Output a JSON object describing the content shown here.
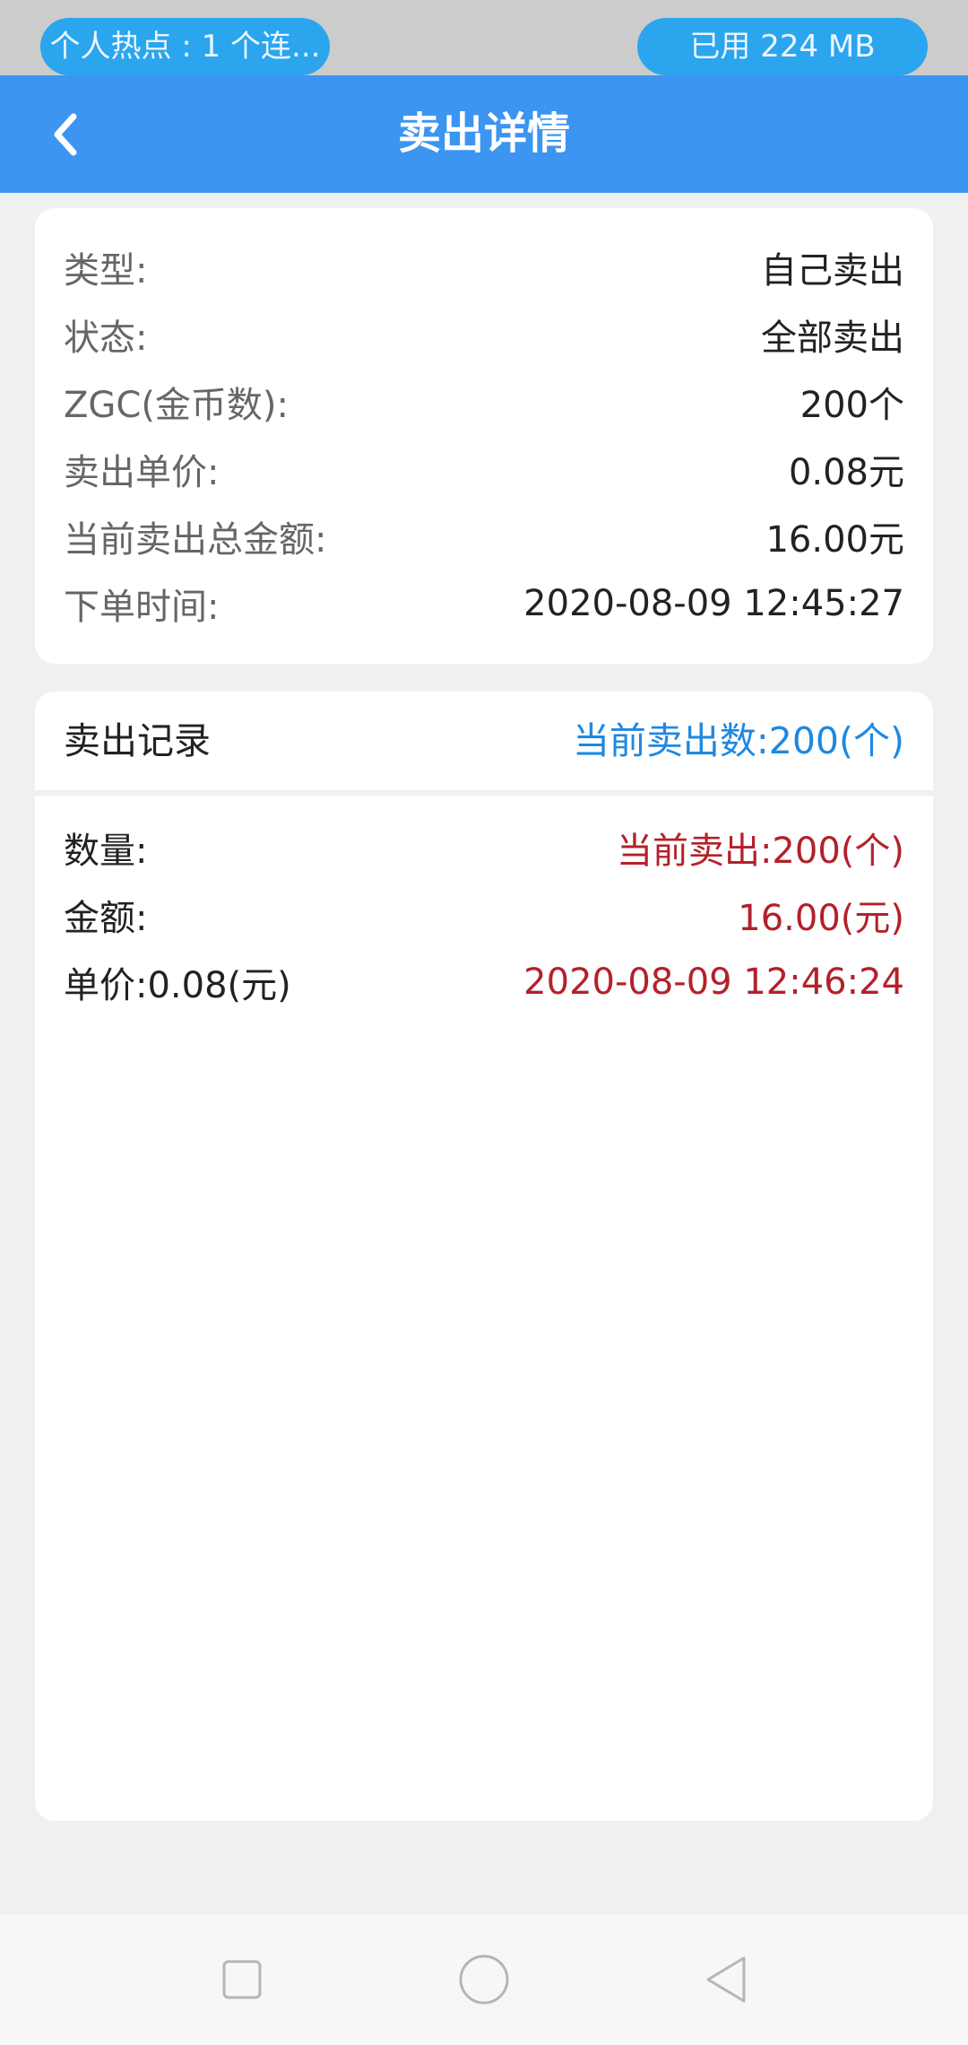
{
  "status_bar": {
    "hotspot": "个人热点 : 1 个连...",
    "data_usage": "已用 224 MB"
  },
  "header": {
    "title": "卖出详情",
    "back_icon": "chevron-left-icon"
  },
  "details": [
    {
      "label": "类型:",
      "value": "自己卖出"
    },
    {
      "label": "状态:",
      "value": "全部卖出"
    },
    {
      "label": "ZGC(金币数):",
      "value": "200个"
    },
    {
      "label": "卖出单价:",
      "value": "0.08元"
    },
    {
      "label": "当前卖出总金额:",
      "value": "16.00元"
    },
    {
      "label": "下单时间:",
      "value": "2020-08-09 12:45:27"
    }
  ],
  "records": {
    "title": "卖出记录",
    "count": "当前卖出数:200(个)",
    "items": [
      {
        "quantity_label": "数量:",
        "quantity_value": "当前卖出:200(个)",
        "amount_label": "金额:",
        "amount_value": "16.00(元)",
        "price": "单价:0.08(元)",
        "time": "2020-08-09 12:46:24"
      }
    ]
  },
  "system_nav": {
    "recents_icon": "square-icon",
    "home_icon": "circle-icon",
    "back_icon": "triangle-back-icon"
  },
  "colors": {
    "nav_bar": "#3b95f1",
    "accent_blue": "#1f88e0",
    "accent_red": "#b3212a"
  }
}
